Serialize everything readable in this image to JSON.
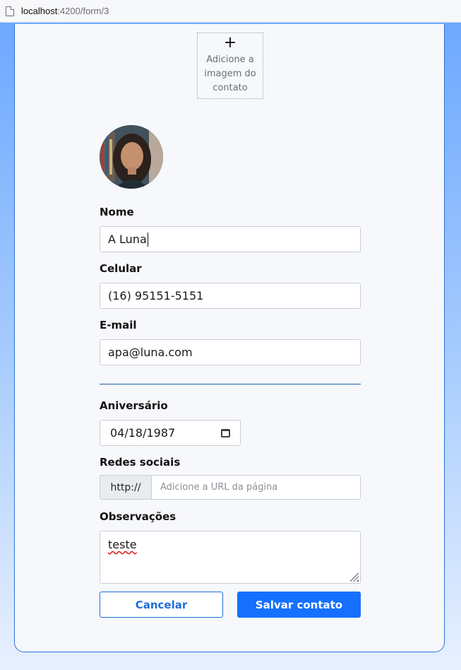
{
  "browser": {
    "host": "localhost",
    "path": ":4200/form/3"
  },
  "form": {
    "image_upload": {
      "plus": "+",
      "text": "Adicione a imagem do contato"
    },
    "name": {
      "label": "Nome",
      "value": "A Luna"
    },
    "phone": {
      "label": "Celular",
      "value": "(16) 95151-5151"
    },
    "email": {
      "label": "E-mail",
      "value": "apa@luna.com"
    },
    "birthday": {
      "label": "Aniversário",
      "value": "04/18/1987"
    },
    "social": {
      "label": "Redes sociais",
      "prefix": "http://",
      "placeholder": "Adicione a URL da página"
    },
    "notes": {
      "label": "Observações",
      "value": "teste"
    },
    "buttons": {
      "cancel": "Cancelar",
      "save": "Salvar contato"
    }
  },
  "colors": {
    "accent": "#1670ff",
    "card_border": "#2f72d8",
    "divider": "#1e5fa6"
  },
  "icons": {
    "page": "page-icon",
    "calendar": "calendar-icon",
    "resize": "resize-grip-icon"
  }
}
